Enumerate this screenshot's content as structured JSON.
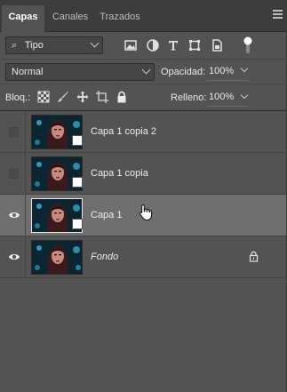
{
  "tabs": [
    {
      "label": "Capas",
      "active": true
    },
    {
      "label": "Canales",
      "active": false
    },
    {
      "label": "Trazados",
      "active": false
    }
  ],
  "filter": {
    "kind_label": "Tipo",
    "buttons": [
      "image-filter-icon",
      "adjustment-filter-icon",
      "type-filter-icon",
      "shape-filter-icon",
      "smart-object-filter-icon"
    ],
    "toggle": "filter-toggle-icon"
  },
  "blend": {
    "mode": "Normal",
    "opacity_label": "Opacidad:",
    "opacity_value": "100%"
  },
  "lock": {
    "label": "Bloq.:",
    "icons": [
      "lock-pixels-icon",
      "lock-image-pixels-icon",
      "lock-position-icon",
      "lock-artboard-icon",
      "lock-all-icon"
    ],
    "fill_label": "Relleno:",
    "fill_value": "100%"
  },
  "layers": [
    {
      "name": "Capa 1 copia 2",
      "visible": false,
      "selected": false,
      "smart_object": true,
      "locked": false,
      "italic": false
    },
    {
      "name": "Capa 1 copia",
      "visible": false,
      "selected": false,
      "smart_object": true,
      "locked": false,
      "italic": false
    },
    {
      "name": "Capa 1",
      "visible": true,
      "selected": true,
      "smart_object": true,
      "locked": false,
      "italic": false
    },
    {
      "name": "Fondo",
      "visible": true,
      "selected": false,
      "smart_object": false,
      "locked": true,
      "italic": true
    }
  ],
  "colors": {
    "panel_bg": "#535353",
    "tabbar_bg": "#3d3d3d",
    "selected_row": "#6f6f6f",
    "text": "#e8e8e8"
  }
}
